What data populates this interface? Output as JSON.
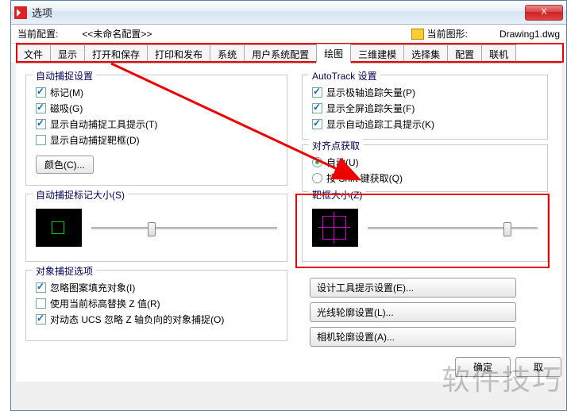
{
  "window": {
    "title": "选项"
  },
  "profile": {
    "label": "当前配置:",
    "value": "<<未命名配置>>",
    "drawing_label": "当前图形:",
    "drawing_value": "Drawing1.dwg"
  },
  "tabs": [
    "文件",
    "显示",
    "打开和保存",
    "打印和发布",
    "系统",
    "用户系统配置",
    "绘图",
    "三维建模",
    "选择集",
    "配置",
    "联机"
  ],
  "active_tab_index": 6,
  "autosnap": {
    "title": "自动捕捉设置",
    "items": [
      {
        "label": "标记(M)",
        "checked": true
      },
      {
        "label": "磁吸(G)",
        "checked": true
      },
      {
        "label": "显示自动捕捉工具提示(T)",
        "checked": true
      },
      {
        "label": "显示自动捕捉靶框(D)",
        "checked": false
      }
    ],
    "color_btn": "颜色(C)..."
  },
  "autotrack": {
    "title": "AutoTrack 设置",
    "items": [
      {
        "label": "显示极轴追踪矢量(P)",
        "checked": true
      },
      {
        "label": "显示全屏追踪矢量(F)",
        "checked": true
      },
      {
        "label": "显示自动追踪工具提示(K)",
        "checked": true
      }
    ]
  },
  "align": {
    "title": "对齐点获取",
    "items": [
      {
        "label": "自动(U)",
        "checked": true
      },
      {
        "label": "按 Shift 键获取(Q)",
        "checked": false
      }
    ]
  },
  "marker_size": {
    "title": "自动捕捉标记大小(S)",
    "value": 30
  },
  "aperture_size": {
    "title": "靶框大小(Z)",
    "value": 80
  },
  "obj_snap": {
    "title": "对象捕捉选项",
    "items": [
      {
        "label": "忽略图案填充对象(I)",
        "checked": true
      },
      {
        "label": "使用当前标高替换 Z 值(R)",
        "checked": false
      },
      {
        "label": "对动态 UCS 忽略 Z 轴负向的对象捕捉(O)",
        "checked": true
      }
    ]
  },
  "right_buttons": [
    "设计工具提示设置(E)...",
    "光线轮廓设置(L)...",
    "相机轮廓设置(A)..."
  ],
  "footer": {
    "ok": "确定",
    "cancel": "取"
  },
  "watermark": "软件技巧"
}
